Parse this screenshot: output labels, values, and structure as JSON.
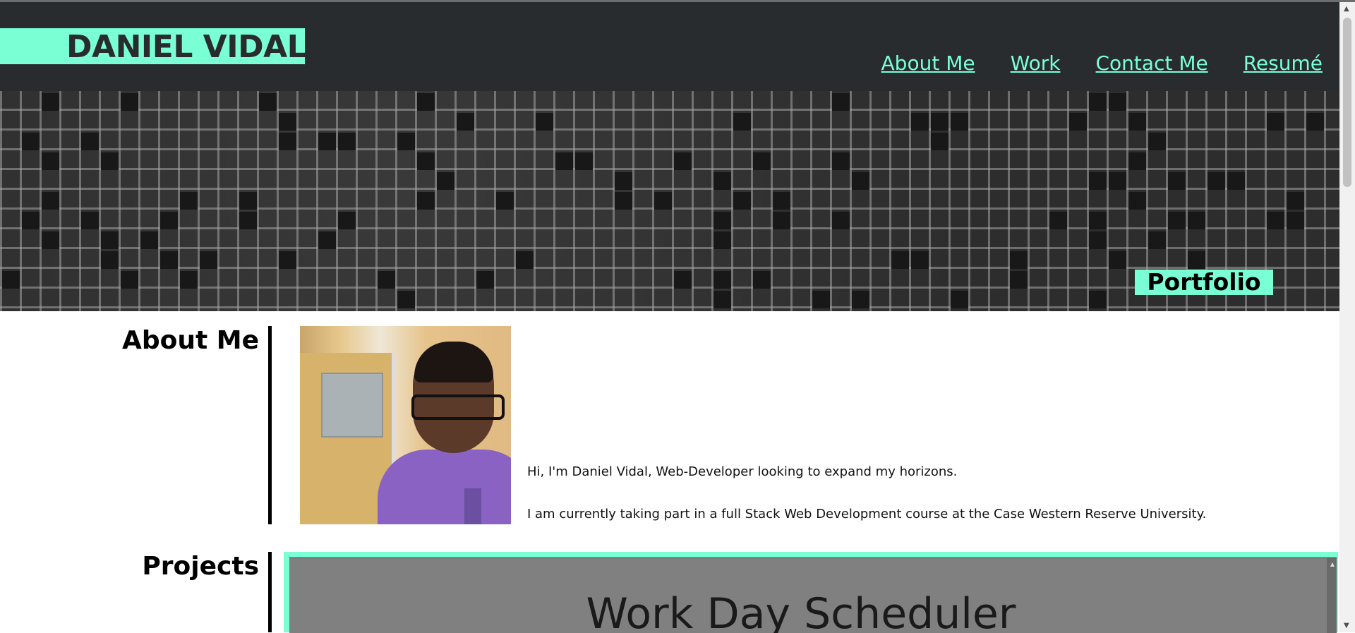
{
  "header": {
    "brand_name": "DANIEL VIDAL",
    "nav": [
      "About Me",
      "Work",
      "Contact Me",
      "Resumé"
    ]
  },
  "hero": {
    "badge": "Portfolio"
  },
  "about": {
    "title": "About Me",
    "photo_icon": "portrait-photo",
    "paragraph1": "Hi, I'm Daniel Vidal, Web-Developer looking to expand my horizons.",
    "paragraph2": "I am currently taking part in a full Stack Web Development course at the Case Western Reserve University."
  },
  "projects": {
    "title": "Projects",
    "first_project_title": "Work Day Scheduler"
  },
  "colors": {
    "accent": "#7affd4",
    "header_bg": "#282c2f",
    "project_bg": "#808080"
  }
}
